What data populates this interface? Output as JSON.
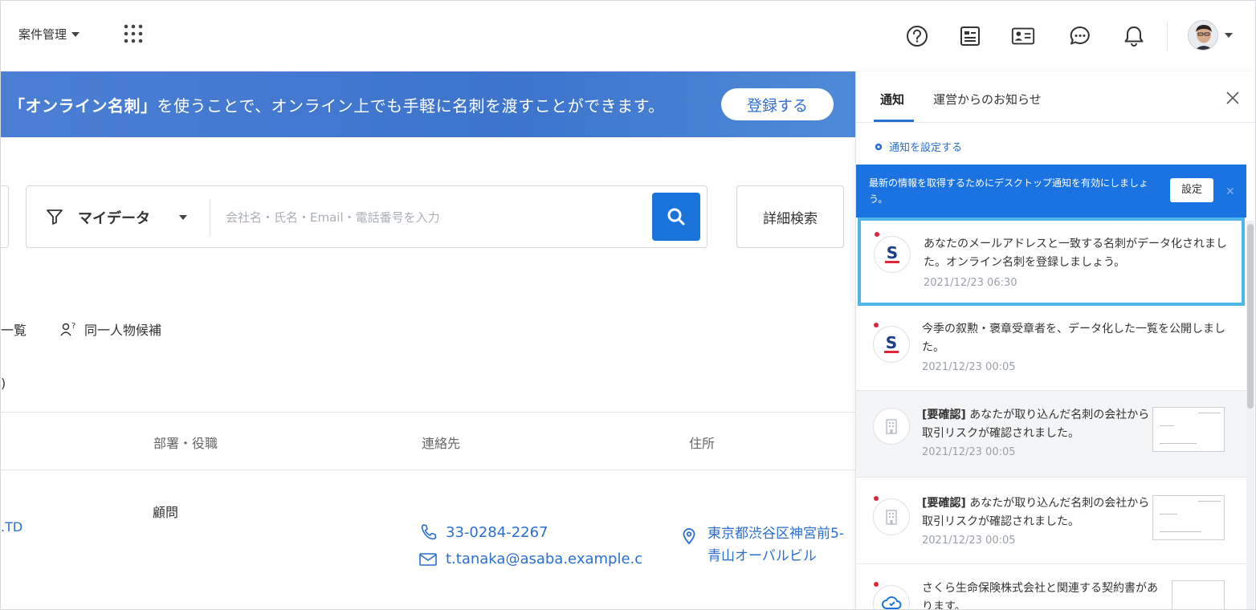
{
  "header": {
    "project_menu": "案件管理",
    "icons": [
      "help-icon",
      "list-card-icon",
      "profile-card-icon",
      "chat-icon",
      "bell-icon",
      "avatar"
    ]
  },
  "banner": {
    "highlight": "「オンライン名刺」",
    "text": "を使うことで、オンライン上でも手軽に名刺を渡すことができます。",
    "button": "登録する"
  },
  "search": {
    "scope": "マイデータ",
    "placeholder": "会社名・氏名・Email・電話番号を入力",
    "detail_button": "詳細検索"
  },
  "links": {
    "list_fragment": "一覧",
    "duplicate_candidates": "同一人物候補",
    "paren_fragment": ")"
  },
  "table": {
    "headers": {
      "department": "部署・役職",
      "contact": "連絡先",
      "address": "住所"
    },
    "row": {
      "company_fragment": ".TD",
      "role": "顧問",
      "phone": "33-0284-2267",
      "email": "t.tanaka@asaba.example.c",
      "address_line1": "東京都渋谷区神宮前5-",
      "address_line2": "青山オーバルビル"
    }
  },
  "panel": {
    "tab_notifications": "通知",
    "tab_announcements": "運営からのお知らせ",
    "settings_link": "通知を設定する",
    "desktop_bar_text": "最新の情報を取得するためにデスクトップ通知を有効にしましょう。",
    "desktop_bar_button": "設定",
    "items": [
      {
        "text": "あなたのメールアドレスと一致する名刺がデータ化されました。オンライン名刺を登録しましょう。",
        "time": "2021/12/23 06:30"
      },
      {
        "text": "今季の叙勲・褒章受章者を、データ化した一覧を公開しました。",
        "time": "2021/12/23 00:05"
      },
      {
        "tag": "[要確認]",
        "text": " あなたが取り込んだ名刺の会社から取引リスクが確認されました。",
        "time": "2021/12/23 00:05"
      },
      {
        "tag": "[要確認]",
        "text": " あなたが取り込んだ名刺の会社から取引リスクが確認されました。",
        "time": "2021/12/23 00:05"
      },
      {
        "text": "さくら生命保険株式会社と関連する契約書があります。"
      }
    ]
  },
  "colors": {
    "accent": "#1a73d9",
    "unread": "#e2263a",
    "highlight_border": "#4fb6ea"
  }
}
